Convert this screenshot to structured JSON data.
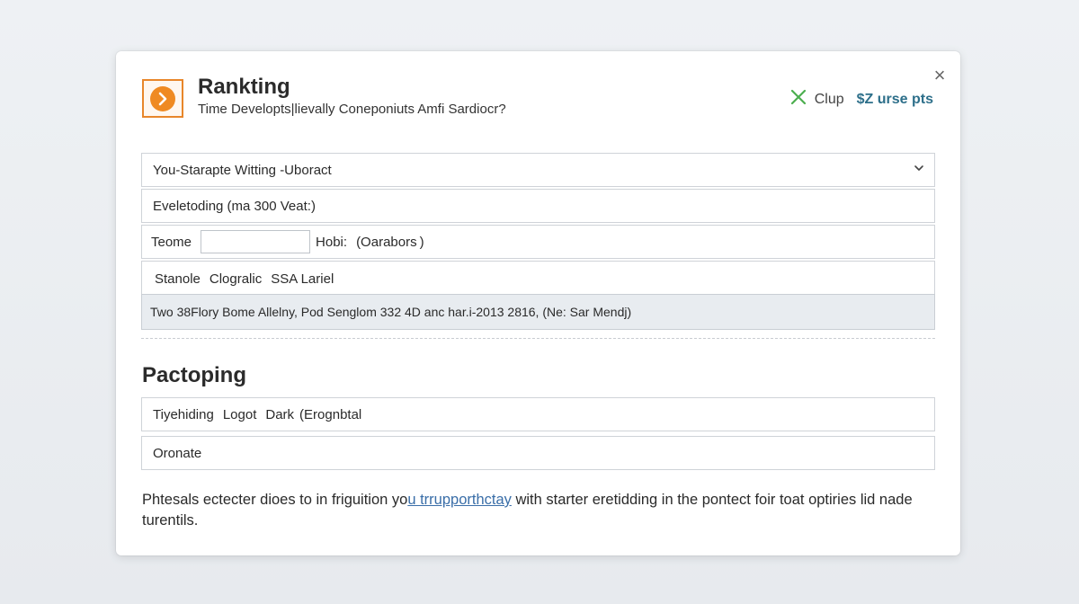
{
  "dialog": {
    "close_symbol": "×",
    "header": {
      "title": "Rankting",
      "subtitle": "Time Developts|lievally Coneponiuts Amfi Sardiocr?",
      "app_icon": "orange-arrow-right-icon",
      "action_clup_label": "Clup",
      "action_clup_icon": "green-x-icon",
      "points_label": "$Z urse pts"
    },
    "fields": {
      "select_value": "You-Starapte Witting -Uboract",
      "row2_text": "Eveletoding (ma 300 Veat:)",
      "row3_label": "Teome",
      "row3_input_value": "",
      "row3_after_a": "Hobi:",
      "row3_after_b": "(Oarabors )",
      "row4_a": "Stanole",
      "row4_b": "Clogralic",
      "row4_c": "SSA Lariel",
      "row5_text": "Two 38Flory Bome Allelny, Pod Senglom 332 4D anc har.i-2013 2816, (Ne: Sar Mendj)"
    },
    "section": {
      "title": "Pactoping",
      "p1_a": "Tiyehiding",
      "p1_b": "Logot",
      "p1_c": "Dark",
      "p1_d": "(Erognbtal",
      "p2_text": "Oronate"
    },
    "footer": {
      "text_before": "Phtesals ectecter dioes to in friguition yo",
      "link_text": "u trrupporthctay",
      "text_after": " with starter eretidding in the pontect foir toat optiries lid nade turentils."
    },
    "colors": {
      "accent_orange": "#ef8a22",
      "accent_green": "#4cae4f",
      "points_blue": "#2d6f8a",
      "link_blue": "#3a6ea8"
    }
  }
}
